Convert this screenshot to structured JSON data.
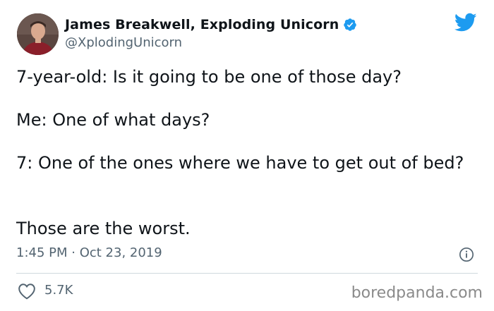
{
  "author": {
    "display_name": "James Breakwell, Exploding Unicorn",
    "handle": "@XplodingUnicorn",
    "verified": true
  },
  "tweet": {
    "lines": [
      "7-year-old: Is it going to be one of those day?",
      "Me: One of what days?",
      "7: One of the ones where we have to get out of bed?",
      "Those are the worst."
    ],
    "timestamp": "1:45 PM · Oct 23, 2019",
    "likes": "5.7K"
  },
  "watermark": "boredpanda.com",
  "icons": {
    "avatar": "avatar-photo",
    "verified": "verified-badge-icon",
    "logo": "twitter-bird-icon",
    "info": "info-icon",
    "like": "heart-icon"
  },
  "colors": {
    "text": "#0f1419",
    "secondary": "#536471",
    "twitter_blue": "#1d9bf0",
    "divider": "#cfd9de",
    "watermark": "#8a8a8a"
  }
}
